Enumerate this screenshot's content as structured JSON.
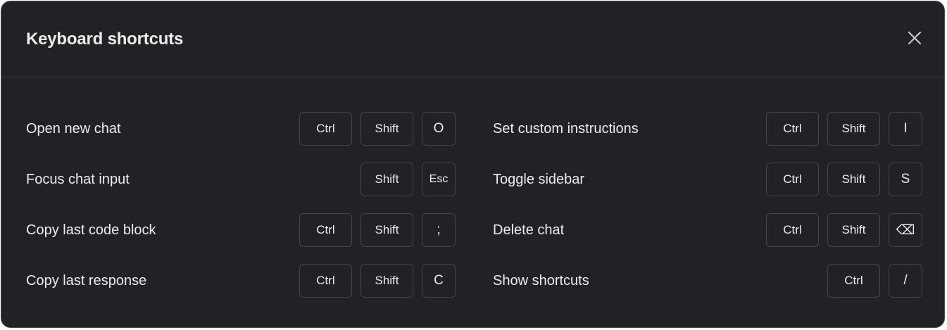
{
  "dialog": {
    "title": "Keyboard shortcuts",
    "close_icon": "close-icon"
  },
  "shortcuts": {
    "left": [
      {
        "label": "Open new chat",
        "keys": [
          "Ctrl",
          "Shift",
          "O"
        ]
      },
      {
        "label": "Focus chat input",
        "keys": [
          "Shift",
          "Esc"
        ]
      },
      {
        "label": "Copy last code block",
        "keys": [
          "Ctrl",
          "Shift",
          ";"
        ]
      },
      {
        "label": "Copy last response",
        "keys": [
          "Ctrl",
          "Shift",
          "C"
        ]
      }
    ],
    "right": [
      {
        "label": "Set custom instructions",
        "keys": [
          "Ctrl",
          "Shift",
          "I"
        ]
      },
      {
        "label": "Toggle sidebar",
        "keys": [
          "Ctrl",
          "Shift",
          "S"
        ]
      },
      {
        "label": "Delete chat",
        "keys": [
          "Ctrl",
          "Shift",
          "⌫"
        ]
      },
      {
        "label": "Show shortcuts",
        "keys": [
          "Ctrl",
          "/"
        ]
      }
    ]
  },
  "colors": {
    "background": "#212225",
    "border": "#444549",
    "text": "#ececec"
  }
}
